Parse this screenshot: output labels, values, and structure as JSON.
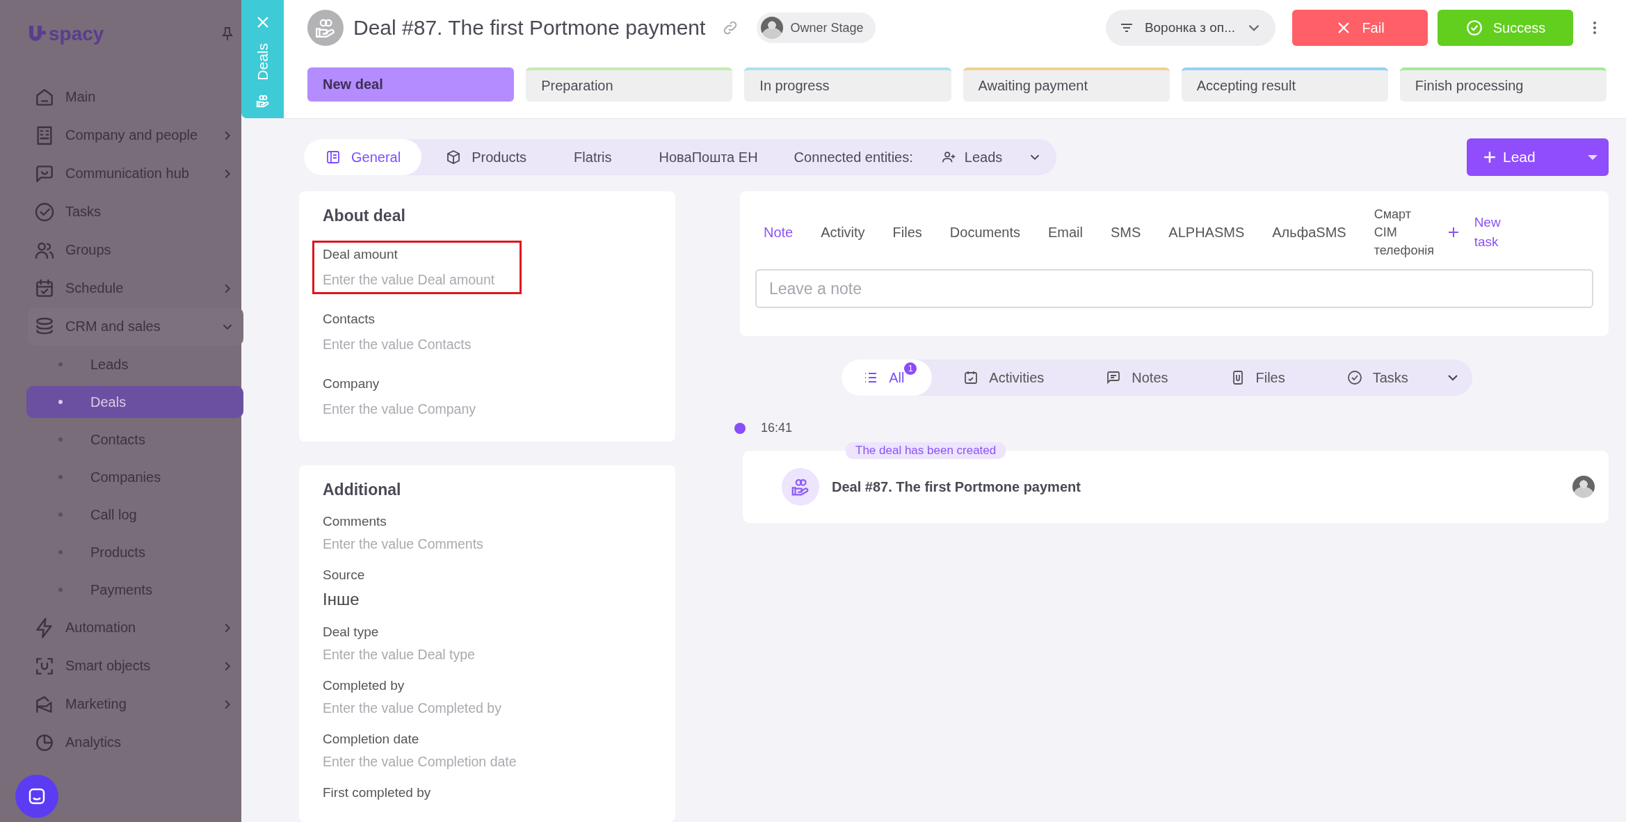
{
  "sidebar": {
    "logo": "spacy",
    "items": [
      {
        "label": "Main",
        "has_children": false,
        "expanded": false,
        "selected": false
      },
      {
        "label": "Company and people",
        "has_children": true,
        "expanded": false,
        "selected": false
      },
      {
        "label": "Communication hub",
        "has_children": true,
        "expanded": false,
        "selected": false
      },
      {
        "label": "Tasks",
        "has_children": false,
        "expanded": false,
        "selected": false
      },
      {
        "label": "Groups",
        "has_children": false,
        "expanded": false,
        "selected": false
      },
      {
        "label": "Schedule",
        "has_children": true,
        "expanded": false,
        "selected": false
      },
      {
        "label": "CRM and sales",
        "has_children": true,
        "expanded": true,
        "selected": false,
        "children": [
          {
            "label": "Leads",
            "selected": false
          },
          {
            "label": "Deals",
            "selected": true
          },
          {
            "label": "Contacts",
            "selected": false
          },
          {
            "label": "Companies",
            "selected": false
          },
          {
            "label": "Call log",
            "selected": false
          },
          {
            "label": "Products",
            "selected": false
          },
          {
            "label": "Payments",
            "selected": false
          }
        ]
      },
      {
        "label": "Automation",
        "has_children": true,
        "expanded": false,
        "selected": false
      },
      {
        "label": "Smart objects",
        "has_children": true,
        "expanded": false,
        "selected": false
      },
      {
        "label": "Marketing",
        "has_children": true,
        "expanded": false,
        "selected": false
      },
      {
        "label": "Analytics",
        "has_children": false,
        "expanded": false,
        "selected": false
      }
    ]
  },
  "side_tab": {
    "label": "Deals"
  },
  "header": {
    "title": "Deal #87. The first Portmone payment",
    "owner": "Owner Stage",
    "funnel": "Воронка з оп...",
    "fail": "Fail",
    "success": "Success"
  },
  "stages": [
    {
      "label": "New deal",
      "selected": true,
      "color": "#b48cff"
    },
    {
      "label": "Preparation",
      "selected": false,
      "color": "#c4ecae"
    },
    {
      "label": "In progress",
      "selected": false,
      "color": "#a8e2ef"
    },
    {
      "label": "Awaiting payment",
      "selected": false,
      "color": "#f2d08f"
    },
    {
      "label": "Accepting result",
      "selected": false,
      "color": "#93d2f4"
    },
    {
      "label": "Finish processing",
      "selected": false,
      "color": "#a3eb95"
    }
  ],
  "tabs": [
    {
      "label": "General",
      "selected": true
    },
    {
      "label": "Products",
      "selected": false
    },
    {
      "label": "Flatris",
      "selected": false
    },
    {
      "label": "НоваПошта ЕН",
      "selected": false
    }
  ],
  "connected": {
    "label": "Connected entities:",
    "value": "Leads"
  },
  "add_button": "Lead",
  "about": {
    "title": "About deal",
    "fields": [
      {
        "label": "Deal amount",
        "placeholder": "Enter the value Deal amount",
        "highlighted": true
      },
      {
        "label": "Contacts",
        "placeholder": "Enter the value Contacts",
        "highlighted": false
      },
      {
        "label": "Company",
        "placeholder": "Enter the value Company",
        "highlighted": false
      }
    ]
  },
  "additional": {
    "title": "Additional",
    "fields": [
      {
        "label": "Comments",
        "placeholder": "Enter the value Comments"
      },
      {
        "label": "Source",
        "value": "Інше"
      },
      {
        "label": "Deal type",
        "placeholder": "Enter the value Deal type"
      },
      {
        "label": "Completed by",
        "placeholder": "Enter the value Completed by"
      },
      {
        "label": "Completion date",
        "placeholder": "Enter the value Completion date"
      },
      {
        "label": "First completed by"
      }
    ]
  },
  "composer": {
    "tabs": [
      {
        "label": "Note",
        "selected": true
      },
      {
        "label": "Activity",
        "selected": false
      },
      {
        "label": "Files",
        "selected": false
      },
      {
        "label": "Documents",
        "selected": false
      },
      {
        "label": "Email",
        "selected": false
      },
      {
        "label": "SMS",
        "selected": false
      },
      {
        "label": "ALPHASMS",
        "selected": false
      },
      {
        "label": "АльфаSMS",
        "selected": false
      },
      {
        "label": "Смарт CIM телефонія",
        "selected": false
      }
    ],
    "new_task": "New task",
    "placeholder": "Leave a note"
  },
  "filters": [
    {
      "label": "All",
      "selected": true,
      "count": "1"
    },
    {
      "label": "Activities",
      "selected": false
    },
    {
      "label": "Notes",
      "selected": false
    },
    {
      "label": "Files",
      "selected": false
    },
    {
      "label": "Tasks",
      "selected": false
    }
  ],
  "timeline": [
    {
      "time": "16:41",
      "badge": "The deal has been created",
      "title": "Deal #87. The first Portmone payment"
    }
  ]
}
